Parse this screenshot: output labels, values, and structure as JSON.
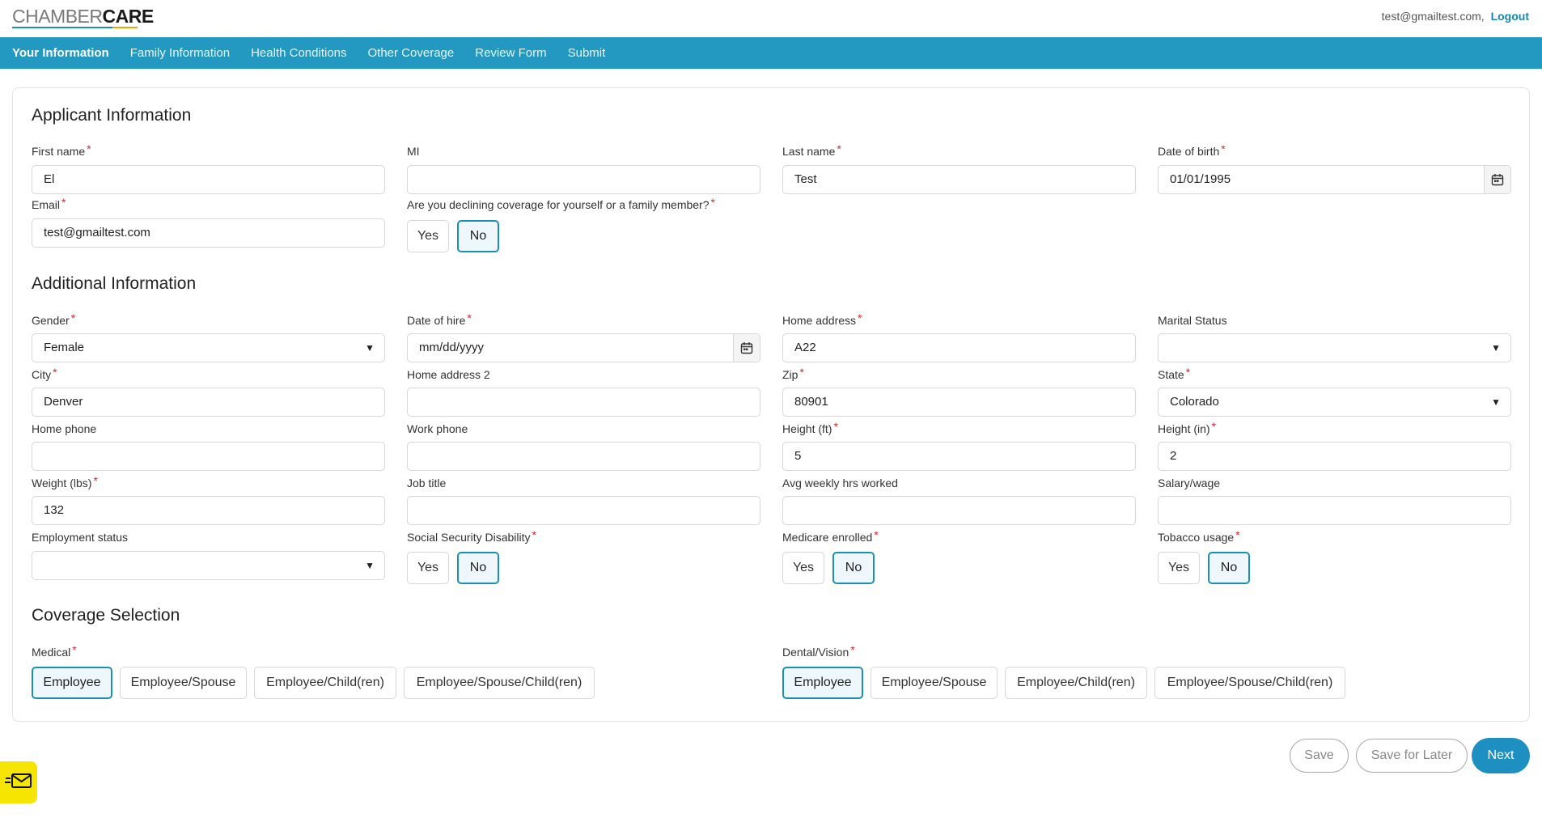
{
  "header": {
    "logo_text_1": "CHAMBER",
    "logo_text_2": "CARE",
    "user_email": "test@gmailtest.com,",
    "logout_label": "Logout"
  },
  "nav": {
    "items": [
      {
        "label": "Your Information",
        "active": true
      },
      {
        "label": "Family Information",
        "active": false
      },
      {
        "label": "Health Conditions",
        "active": false
      },
      {
        "label": "Other Coverage",
        "active": false
      },
      {
        "label": "Review Form",
        "active": false
      },
      {
        "label": "Submit",
        "active": false
      }
    ]
  },
  "applicant": {
    "title": "Applicant Information",
    "first_name": {
      "label": "First name",
      "value": "El"
    },
    "mi": {
      "label": "MI",
      "value": ""
    },
    "last_name": {
      "label": "Last name",
      "value": "Test"
    },
    "dob": {
      "label": "Date of birth",
      "value": "01/01/1995"
    },
    "email": {
      "label": "Email",
      "value": "test@gmailtest.com"
    },
    "declining": {
      "label": "Are you declining coverage for yourself or a family member?",
      "yes": "Yes",
      "no": "No",
      "selected": "No"
    }
  },
  "additional": {
    "title": "Additional Information",
    "gender": {
      "label": "Gender",
      "value": "Female"
    },
    "date_of_hire": {
      "label": "Date of hire",
      "placeholder": "mm/dd/yyyy"
    },
    "home_address": {
      "label": "Home address",
      "value": "A22"
    },
    "marital_status": {
      "label": "Marital Status",
      "value": ""
    },
    "city": {
      "label": "City",
      "value": "Denver"
    },
    "home_address_2": {
      "label": "Home address 2",
      "value": ""
    },
    "zip": {
      "label": "Zip",
      "value": "80901"
    },
    "state": {
      "label": "State",
      "value": "Colorado"
    },
    "home_phone": {
      "label": "Home phone",
      "value": ""
    },
    "work_phone": {
      "label": "Work phone",
      "value": ""
    },
    "height_ft": {
      "label": "Height (ft)",
      "value": "5"
    },
    "height_in": {
      "label": "Height (in)",
      "value": "2"
    },
    "weight": {
      "label": "Weight (lbs)",
      "value": "132"
    },
    "job_title": {
      "label": "Job title",
      "value": ""
    },
    "avg_hours": {
      "label": "Avg weekly hrs worked",
      "value": ""
    },
    "salary": {
      "label": "Salary/wage",
      "value": ""
    },
    "employment_status": {
      "label": "Employment status",
      "value": ""
    },
    "ssd": {
      "label": "Social Security Disability",
      "yes": "Yes",
      "no": "No",
      "selected": "No"
    },
    "medicare": {
      "label": "Medicare enrolled",
      "yes": "Yes",
      "no": "No",
      "selected": "No"
    },
    "tobacco": {
      "label": "Tobacco usage",
      "yes": "Yes",
      "no": "No",
      "selected": "No"
    }
  },
  "coverage": {
    "title": "Coverage Selection",
    "medical": {
      "label": "Medical",
      "options": [
        "Employee",
        "Employee/Spouse",
        "Employee/Child(ren)",
        "Employee/Spouse/Child(ren)"
      ],
      "selected": "Employee"
    },
    "dental": {
      "label": "Dental/Vision",
      "options": [
        "Employee",
        "Employee/Spouse",
        "Employee/Child(ren)",
        "Employee/Spouse/Child(ren)"
      ],
      "selected": "Employee"
    }
  },
  "actions": {
    "save": "Save",
    "save_later": "Save for Later",
    "next": "Next"
  },
  "colors": {
    "nav_bg": "#2399c2",
    "accent": "#1d8fb3",
    "required": "#d62b2b",
    "widget": "#f6e500"
  },
  "icons": {
    "calendar": "calendar-icon",
    "dropdown": "chevron-down-icon",
    "mail": "mail-icon"
  },
  "required_mark": "*"
}
